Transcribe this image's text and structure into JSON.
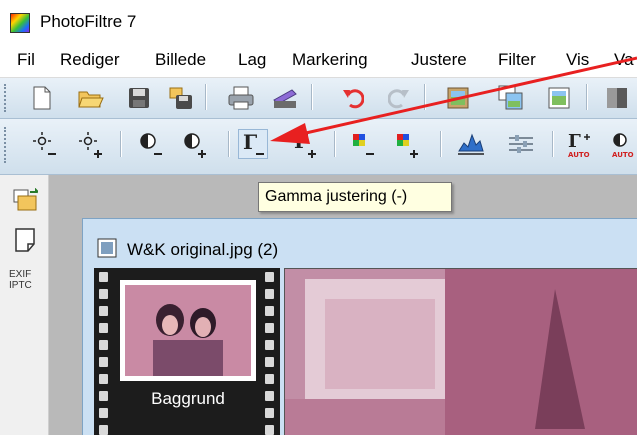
{
  "window": {
    "title": "PhotoFiltre 7",
    "icon": "photofiltre-logo-icon"
  },
  "menu": [
    "Fil",
    "Rediger",
    "Billede",
    "Lag",
    "Markering",
    "Justere",
    "Filter",
    "Vis",
    "Va"
  ],
  "toolbar1": {
    "icons": [
      "new-file-icon",
      "open-folder-icon",
      "save-icon",
      "save-as-icon",
      "print-icon",
      "scanner-icon",
      "undo-icon",
      "redo-icon",
      "paste-image-icon",
      "paste-as-image-icon",
      "new-image-icon",
      "color-swatch-icon"
    ]
  },
  "toolbar2": {
    "icons": [
      "brightness-minus-icon",
      "brightness-plus-icon",
      "contrast-minus-icon",
      "contrast-plus-icon",
      "gamma-minus-icon",
      "gamma-plus-icon",
      "saturation-minus-icon",
      "saturation-plus-icon",
      "histogram-icon",
      "levels-icon",
      "gamma-auto-icon",
      "contrast-auto-icon"
    ],
    "auto_labels": {
      "gamma": "AUTO",
      "contrast": "AUTO"
    },
    "gamma_glyph": "Γ"
  },
  "tooltip": {
    "text": "Gamma justering (-)"
  },
  "left_panel": {
    "exif_line1": "EXIF",
    "exif_line2": "IPTC"
  },
  "document": {
    "title": "W&K original.jpg (2)",
    "layer_label": "Baggrund"
  },
  "colors": {
    "toolbar_bg": "#dbe7f1",
    "tooltip_bg": "#ffffe1",
    "annotation_arrow": "#e82020",
    "doc_window_bg": "#cbe0f3"
  }
}
